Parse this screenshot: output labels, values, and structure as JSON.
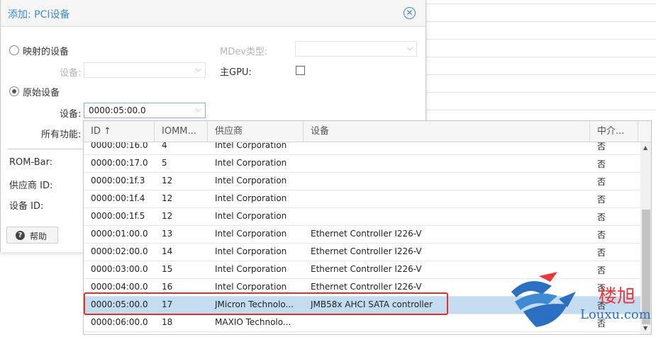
{
  "dialog": {
    "title": "添加: PCI设备",
    "mapped_device_label": "映射的设备",
    "device_label": "设备:",
    "raw_device_label": "原始设备",
    "raw_device_value": "0000:05:00.0",
    "all_functions_label": "所有功能:",
    "rombar_label": "ROM-Bar:",
    "vendor_id_label": "供应商 ID:",
    "device_id_label": "设备 ID:",
    "mdev_type_label": "MDev类型:",
    "primary_gpu_label": "主GPU:",
    "help_label": "帮助"
  },
  "grid": {
    "columns": [
      "ID ↑",
      "IOMM...",
      "供应商",
      "设备",
      "中介..."
    ],
    "rows": [
      {
        "id": "0000:00:16.0",
        "iommu": "4",
        "vendor": "Intel Corporation",
        "device": "",
        "mediated": "否",
        "selected": false
      },
      {
        "id": "0000:00:17.0",
        "iommu": "5",
        "vendor": "Intel Corporation",
        "device": "",
        "mediated": "否",
        "selected": false
      },
      {
        "id": "0000:00:1f.3",
        "iommu": "12",
        "vendor": "Intel Corporation",
        "device": "",
        "mediated": "否",
        "selected": false
      },
      {
        "id": "0000:00:1f.4",
        "iommu": "12",
        "vendor": "Intel Corporation",
        "device": "",
        "mediated": "否",
        "selected": false
      },
      {
        "id": "0000:00:1f.5",
        "iommu": "12",
        "vendor": "Intel Corporation",
        "device": "",
        "mediated": "否",
        "selected": false
      },
      {
        "id": "0000:01:00.0",
        "iommu": "13",
        "vendor": "Intel Corporation",
        "device": "Ethernet Controller I226-V",
        "mediated": "否",
        "selected": false
      },
      {
        "id": "0000:02:00.0",
        "iommu": "14",
        "vendor": "Intel Corporation",
        "device": "Ethernet Controller I226-V",
        "mediated": "否",
        "selected": false
      },
      {
        "id": "0000:03:00.0",
        "iommu": "15",
        "vendor": "Intel Corporation",
        "device": "Ethernet Controller I226-V",
        "mediated": "否",
        "selected": false
      },
      {
        "id": "0000:04:00.0",
        "iommu": "16",
        "vendor": "Intel Corporation",
        "device": "Ethernet Controller I226-V",
        "mediated": "否",
        "selected": false
      },
      {
        "id": "0000:05:00.0",
        "iommu": "17",
        "vendor": "JMicron Technolo...",
        "device": "JMB58x AHCI SATA controller",
        "mediated": "否",
        "selected": true
      },
      {
        "id": "0000:06:00.0",
        "iommu": "18",
        "vendor": "MAXIO Technolo...",
        "device": "",
        "mediated": "否",
        "selected": false
      }
    ]
  },
  "watermark": {
    "cn": "楼旭",
    "en": "Louxu.com"
  },
  "colors": {
    "accent": "#3c8bd4",
    "selection": "#c4dcf0",
    "highlight": "#e0302c"
  }
}
